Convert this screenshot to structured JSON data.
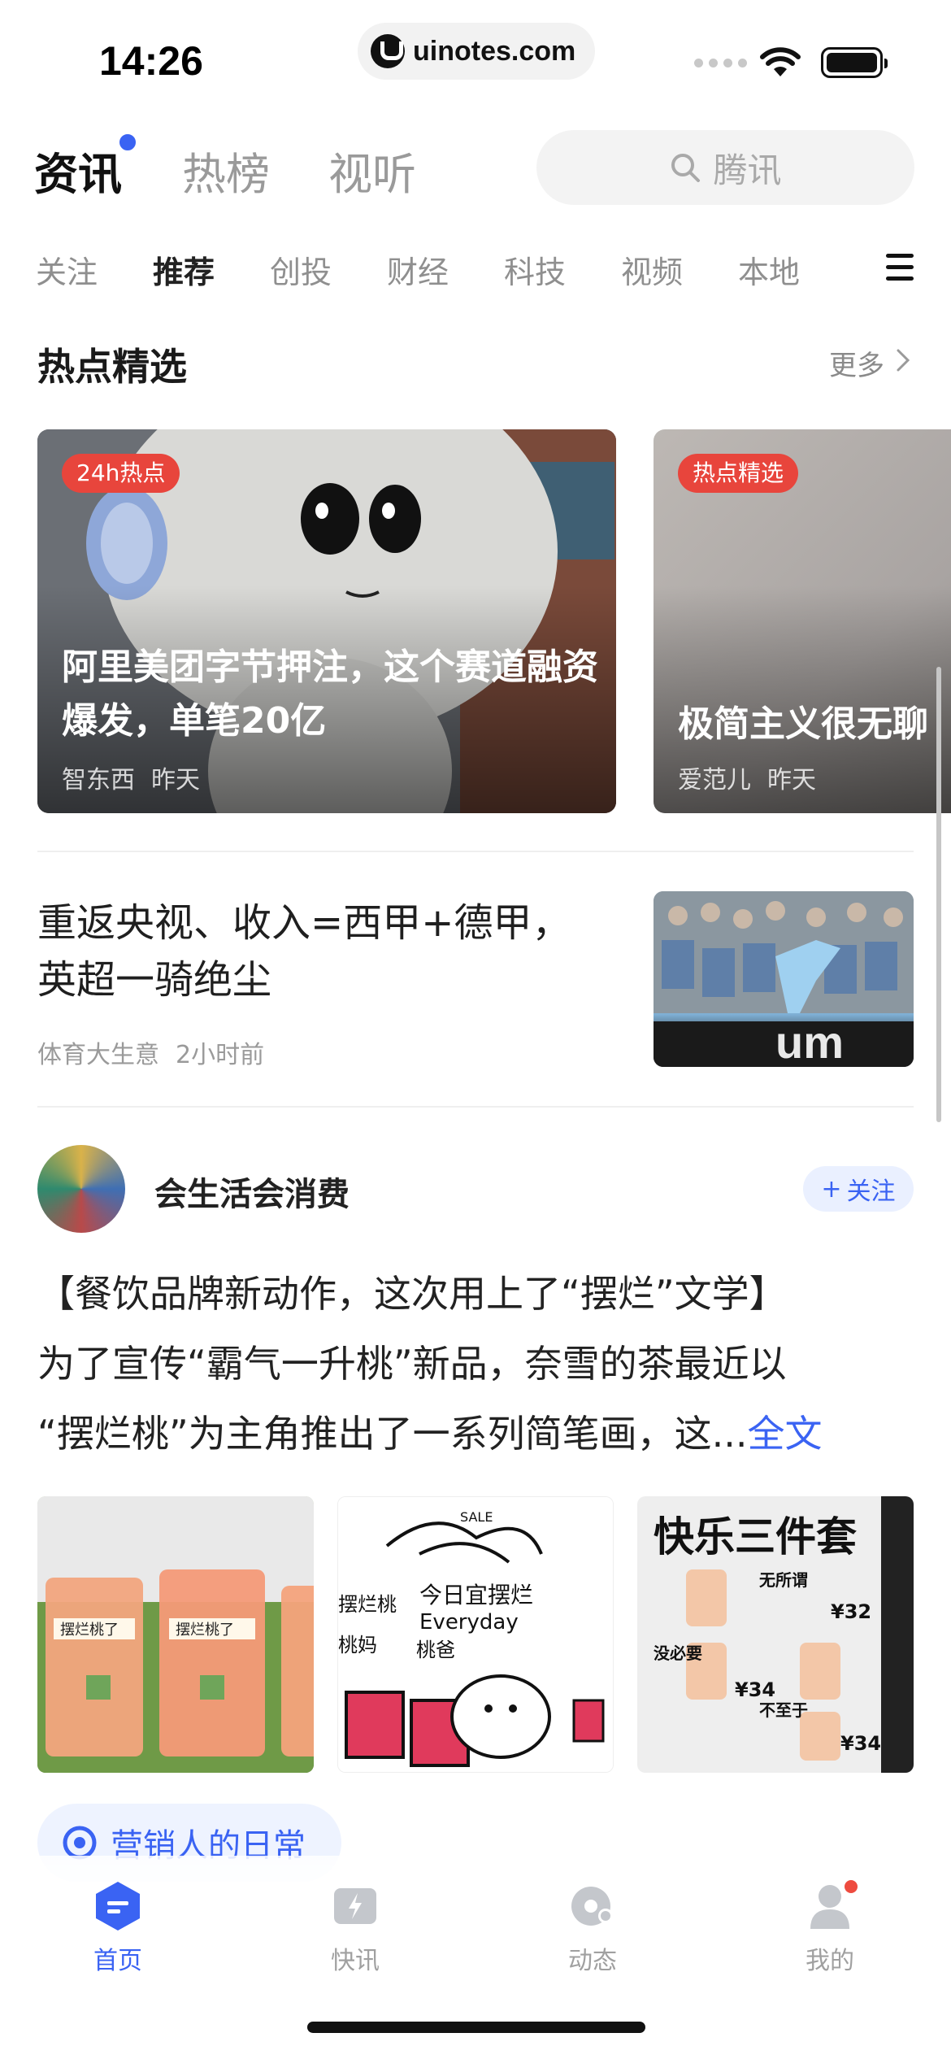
{
  "status_bar": {
    "time": "14:26",
    "url": "uinotes.com"
  },
  "top_nav": {
    "tabs": [
      {
        "label": "资讯",
        "active": true
      },
      {
        "label": "热榜",
        "active": false
      },
      {
        "label": "视听",
        "active": false
      }
    ],
    "search_placeholder": "腾讯"
  },
  "categories": [
    "关注",
    "推荐",
    "创投",
    "财经",
    "科技",
    "视频",
    "本地"
  ],
  "active_category": "推荐",
  "hot_section": {
    "title": "热点精选",
    "more_label": "更多",
    "cards": [
      {
        "badge": "24h热点",
        "title": "阿里美团字节押注，这个赛道融资爆发，单笔20亿",
        "source": "智东西",
        "time": "昨天"
      },
      {
        "badge": "热点精选",
        "title": "极简主义很无聊",
        "source": "爱范儿",
        "time": "昨天"
      }
    ]
  },
  "news_item": {
    "title_lines": [
      "重返央视、收入=西甲+德甲，",
      "英超一骑绝尘"
    ],
    "source": "体育大生意",
    "time": "2小时前"
  },
  "post": {
    "author": "会生活会消费",
    "follow_label": "关注",
    "lines": [
      "【餐饮品牌新动作，这次用上了“摆烂”文学】",
      "为了宣传“霸气一升桃”新品，奈雪的茶最近以",
      "“摆烂桃”为主角推出了一系列简笔画，这..."
    ],
    "full_text_label": "全文",
    "images": {
      "img1_text": "摆烂桃了",
      "img2_lines": [
        "今日宜摆烂",
        "Everyday"
      ],
      "img2_tags": [
        "SALE",
        "摆烂桃",
        "桃妈",
        "桃爸"
      ],
      "img3": {
        "title": "快乐三件套",
        "items": [
          {
            "name": "无所谓",
            "price": "¥32"
          },
          {
            "name": "没必要",
            "price": "¥34"
          },
          {
            "name": "不至于",
            "price": "¥34"
          }
        ]
      }
    },
    "topic": "营销人的日常"
  },
  "tab_bar": {
    "items": [
      {
        "label": "首页",
        "active": true
      },
      {
        "label": "快讯",
        "active": false
      },
      {
        "label": "动态",
        "active": false
      },
      {
        "label": "我的",
        "active": false
      }
    ]
  },
  "colors": {
    "accent": "#3a63f3",
    "badge_red": "#e8453c",
    "text_muted": "#9a9a9a"
  }
}
